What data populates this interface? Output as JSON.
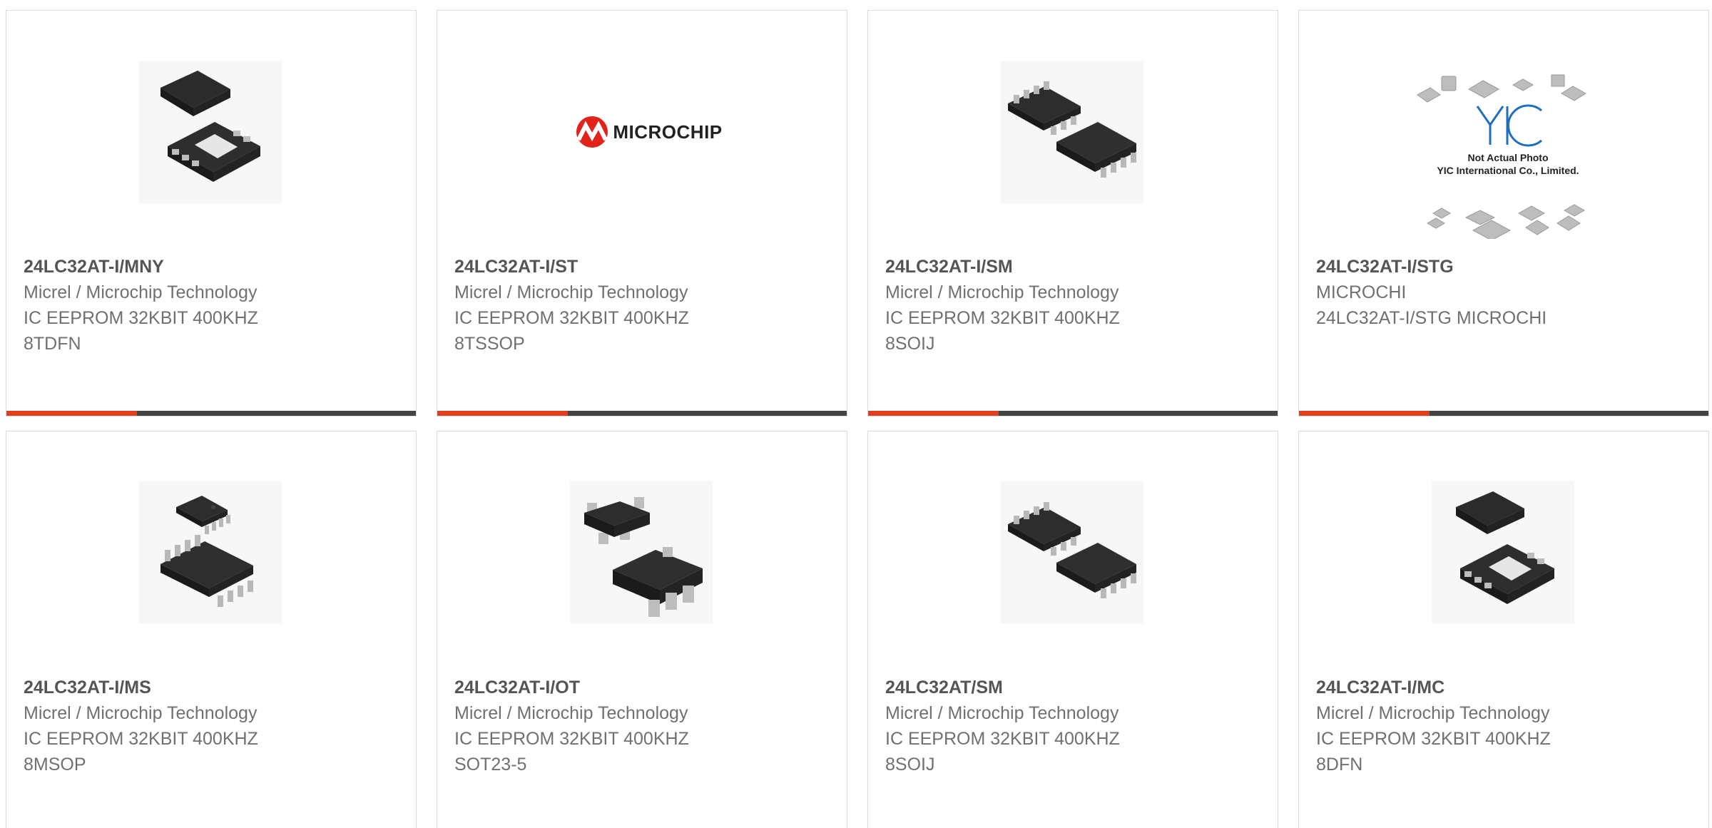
{
  "colors": {
    "accent": "#e2401c",
    "bar_dark": "#444444",
    "part_text": "#555555",
    "detail_text": "#707070",
    "card_border": "#dcdcdc"
  },
  "products": [
    {
      "part": "24LC32AT-I/MNY",
      "manufacturer": "Micrel / Microchip Technology",
      "desc1": "IC EEPROM 32KBIT 400KHZ",
      "desc2": "8TDFN",
      "image": "dfn-package-image"
    },
    {
      "part": "24LC32AT-I/ST",
      "manufacturer": "Micrel / Microchip Technology",
      "desc1": "IC EEPROM 32KBIT 400KHZ",
      "desc2": "8TSSOP",
      "image": "microchip-logo-image",
      "logo_text": "MICROCHIP"
    },
    {
      "part": "24LC32AT-I/SM",
      "manufacturer": "Micrel / Microchip Technology",
      "desc1": "IC EEPROM 32KBIT 400KHZ",
      "desc2": "8SOIJ",
      "image": "soic-package-image"
    },
    {
      "part": "24LC32AT-I/STG",
      "manufacturer": "MICROCHI",
      "desc1": "24LC32AT-I/STG MICROCHI",
      "desc2": "",
      "image": "yic-placeholder-image",
      "placeholder_line1": "Not Actual Photo",
      "placeholder_line2": "YIC International Co., Limited."
    },
    {
      "part": "24LC32AT-I/MS",
      "manufacturer": "Micrel / Microchip Technology",
      "desc1": "IC EEPROM 32KBIT 400KHZ",
      "desc2": "8MSOP",
      "image": "msop-package-image"
    },
    {
      "part": "24LC32AT-I/OT",
      "manufacturer": "Micrel / Microchip Technology",
      "desc1": "IC EEPROM 32KBIT 400KHZ",
      "desc2": "SOT23-5",
      "image": "sot23-package-image"
    },
    {
      "part": "24LC32AT/SM",
      "manufacturer": "Micrel / Microchip Technology",
      "desc1": "IC EEPROM 32KBIT 400KHZ",
      "desc2": "8SOIJ",
      "image": "soic-package-image"
    },
    {
      "part": "24LC32AT-I/MC",
      "manufacturer": "Micrel / Microchip Technology",
      "desc1": "IC EEPROM 32KBIT 400KHZ",
      "desc2": "8DFN",
      "image": "dfn-package-image"
    }
  ]
}
